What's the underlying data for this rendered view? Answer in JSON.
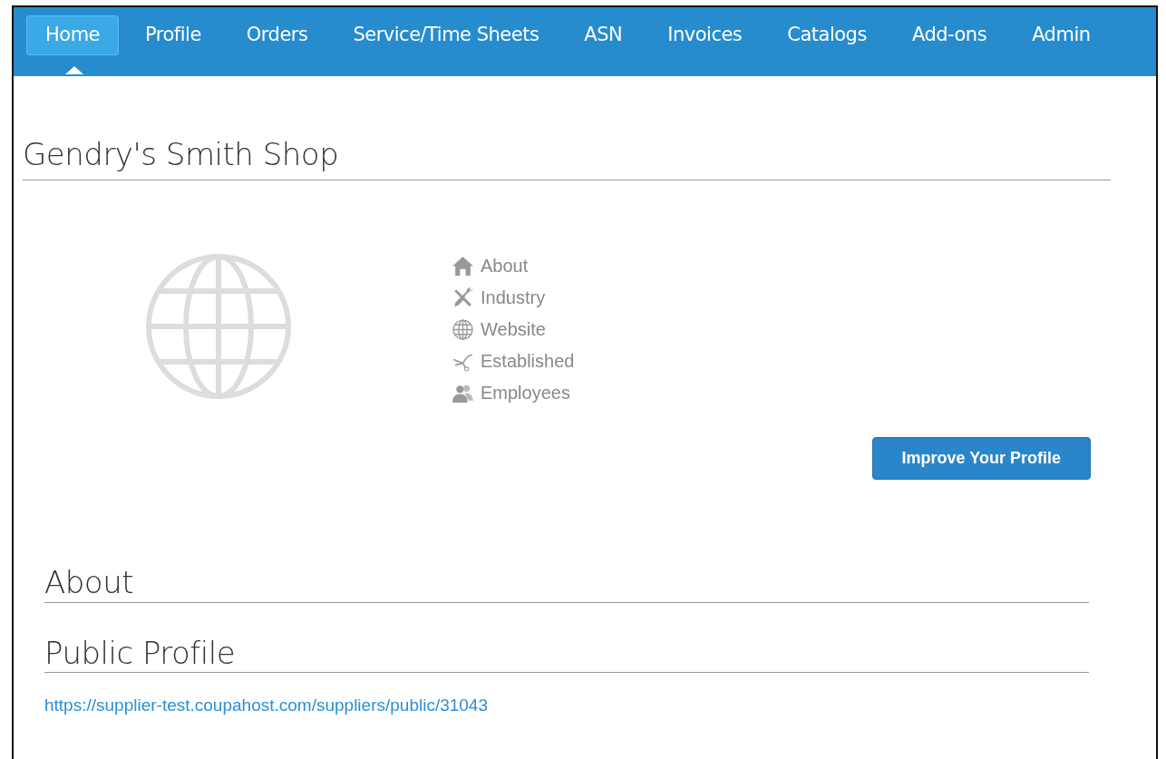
{
  "nav": {
    "tabs": [
      {
        "label": "Home",
        "selected": true
      },
      {
        "label": "Profile",
        "selected": false
      },
      {
        "label": "Orders",
        "selected": false
      },
      {
        "label": "Service/Time Sheets",
        "selected": false
      },
      {
        "label": "ASN",
        "selected": false
      },
      {
        "label": "Invoices",
        "selected": false
      },
      {
        "label": "Catalogs",
        "selected": false
      },
      {
        "label": "Add-ons",
        "selected": false
      },
      {
        "label": "Admin",
        "selected": false
      }
    ]
  },
  "page": {
    "title": "Gendry's Smith Shop",
    "details": [
      {
        "label": "About"
      },
      {
        "label": "Industry"
      },
      {
        "label": "Website"
      },
      {
        "label": "Established"
      },
      {
        "label": "Employees"
      }
    ],
    "improve_button": "Improve Your Profile",
    "sections": [
      {
        "heading": "About"
      },
      {
        "heading": "Public Profile",
        "link": "https://supplier-test.coupahost.com/suppliers/public/31043"
      }
    ]
  }
}
